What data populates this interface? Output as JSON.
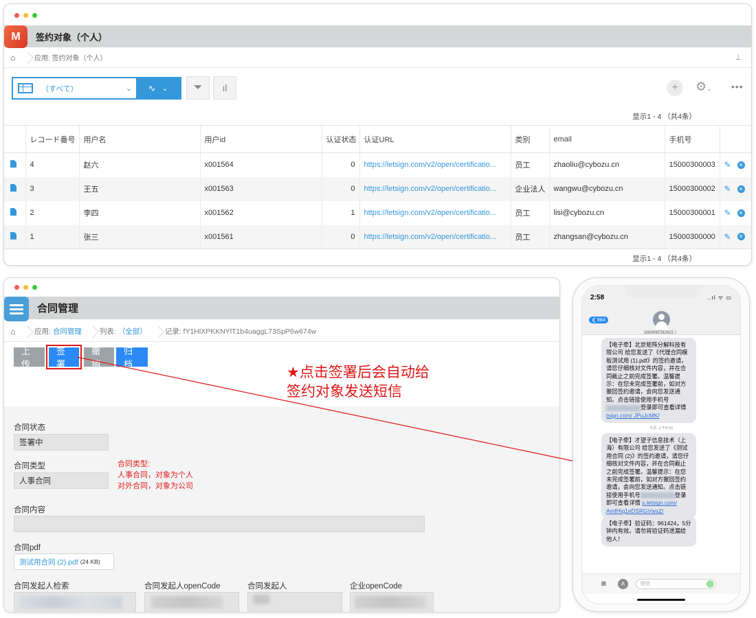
{
  "list_window": {
    "app_title": "签约对象（个人）",
    "app_icon_text": "M",
    "breadcrumb": "应用: 签约对象（个人）",
    "view_selector": "（すべて）",
    "count_top": "显示1 - 4  （共4条）",
    "count_bottom": "显示1 - 4  （共4条）",
    "columns": [
      "レコード番号",
      "用户名",
      "用户id",
      "认证状态",
      "认证URL",
      "类别",
      "email",
      "手机号"
    ],
    "rows": [
      {
        "no": "4",
        "name": "赵六",
        "uid": "x001564",
        "status": "0",
        "url": "https://letsign.com/v2/open/certificatio...",
        "type": "员工",
        "email": "zhaoliu@cybozu.cn",
        "phone": "15000300003"
      },
      {
        "no": "3",
        "name": "王五",
        "uid": "x001563",
        "status": "0",
        "url": "https://letsign.com/v2/open/certificatio...",
        "type": "企业法人",
        "email": "wangwu@cybozu.cn",
        "phone": "15000300002"
      },
      {
        "no": "2",
        "name": "李四",
        "uid": "x001562",
        "status": "1",
        "url": "https://letsign.com/v2/open/certificatio...",
        "type": "员工",
        "email": "lisi@cybozu.cn",
        "phone": "15000300001"
      },
      {
        "no": "1",
        "name": "张三",
        "uid": "x001561",
        "status": "0",
        "url": "https://letsign.com/v2/open/certificatio...",
        "type": "员工",
        "email": "zhangsan@cybozu.cn",
        "phone": "15000300000"
      }
    ]
  },
  "detail_window": {
    "app_title": "合同管理",
    "crumb_app_prefix": "应用:",
    "crumb_app": "合同管理",
    "crumb_list_prefix": "列表:",
    "crumb_list": "（全部）",
    "crumb_record": "记录: fY1HlXPKKNYlT1b4uaggL73SpP6w674w",
    "buttons": {
      "upload": "上传",
      "sign": "签署",
      "revoke": "撤销",
      "archive": "归档"
    },
    "fields": {
      "status_label": "合同状态",
      "status_value": "签署中",
      "type_label": "合同类型",
      "type_value": "人事合同",
      "content_label": "合同内容",
      "pdf_label": "合同pdf",
      "pdf_file": "测试用合同 (2).pdf",
      "pdf_size": "(24 KB)",
      "initiator_search_label": "合同发起人检索",
      "initiator_opencode_label": "合同发起人openCode",
      "initiator_label": "合同发起人",
      "company_opencode_label": "企业openCode"
    },
    "type_note_title": "合同类型:",
    "type_note_line1": "人事合同，对象为个人",
    "type_note_line2": "对外合同，对象为公司"
  },
  "annotation": {
    "line1": "★点击签署后会自动给",
    "line2": "签约对象发送短信"
  },
  "phone": {
    "time": "2:58",
    "signal": "..ıl ᯤ ▭",
    "back_badge": "984",
    "sender": "1069095782915 〉",
    "msg1": {
      "text_a": "【电子牵】北京矩阵分解科技有限公司 给您发送了《代理合同模板测试用 (1).pdf》的签约邀请，请您仔细核对文件内容，并在合同截止之前完成签署。温馨提示：在您未完成签署前，如对方撤回签约邀请，会向您发送通知。点击链接使用手机号",
      "text_b": "登录即可查看详情",
      "link": "tsign.com/ JPuJcMK/"
    },
    "day_label": "今天 上午8:50",
    "msg2": {
      "text_a": "【电子牵】才望子信息技术（上海）有限公司 给您发送了《测试用合同 (2)》的签约邀请，请您仔细核对文件内容，并在合同截止之前完成签署。温馨提示：在您未完成签署前，如对方撤回签约邀请，会向您发送通知。点击链接使用手机号",
      "text_b": "登录即可查看详情",
      "link": "s.letsign.com/ AmfHiq1eDSRGVwsZ/"
    },
    "msg3": {
      "text": "【电子牵】验证码：961424，5分钟内有效。请勿将验证码泄漏给他人！"
    },
    "input_placeholder": "短信"
  }
}
